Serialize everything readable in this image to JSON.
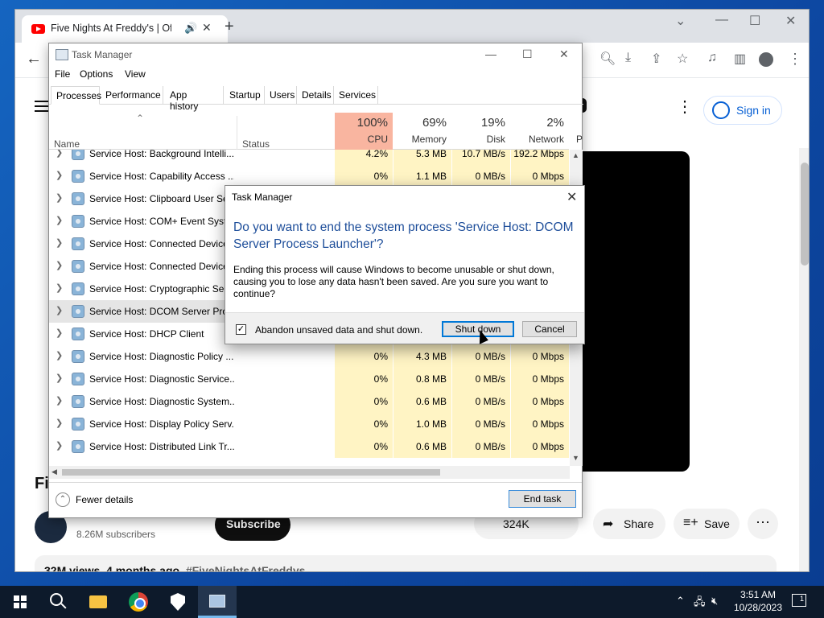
{
  "browser": {
    "tab_title": "Five Nights At Freddy's | Offi",
    "new_tab": "+"
  },
  "youtube": {
    "sign_in": "Sign in",
    "title_partial": "Fi",
    "channel_subscribers": "8.26M subscribers",
    "subscribe": "Subscribe",
    "likes_partial": "324K",
    "share": "Share",
    "save": "Save",
    "views": "32M views",
    "age": "4 months ago",
    "hashtag": "#FiveNightsAtFreddys"
  },
  "task_manager": {
    "title": "Task Manager",
    "menu": [
      "File",
      "Options",
      "View"
    ],
    "tabs": [
      "Processes",
      "Performance",
      "App history",
      "Startup",
      "Users",
      "Details",
      "Services"
    ],
    "columns": {
      "name": "Name",
      "status": "Status",
      "cpu_pct": "100%",
      "cpu": "CPU",
      "mem_pct": "69%",
      "mem": "Memory",
      "disk_pct": "19%",
      "disk": "Disk",
      "net_pct": "2%",
      "net": "Network",
      "power_partial": "P"
    },
    "rows": [
      {
        "name": "Service Host: Background Intelli...",
        "cpu": "4.2%",
        "mem": "5.3 MB",
        "disk": "10.7 MB/s",
        "net": "192.2 Mbps"
      },
      {
        "name": "Service Host: Capability Access ...",
        "cpu": "0%",
        "mem": "1.1 MB",
        "disk": "0 MB/s",
        "net": "0 Mbps"
      },
      {
        "name": "Service Host: Clipboard User Ser",
        "cpu": "",
        "mem": "",
        "disk": "",
        "net": ""
      },
      {
        "name": "Service Host: COM+ Event Syste",
        "cpu": "",
        "mem": "",
        "disk": "",
        "net": ""
      },
      {
        "name": "Service Host: Connected Device",
        "cpu": "",
        "mem": "",
        "disk": "",
        "net": ""
      },
      {
        "name": "Service Host: Connected Device",
        "cpu": "",
        "mem": "",
        "disk": "",
        "net": ""
      },
      {
        "name": "Service Host: Cryptographic Ser",
        "cpu": "",
        "mem": "",
        "disk": "",
        "net": ""
      },
      {
        "name": "Service Host: DCOM Server Proc",
        "cpu": "",
        "mem": "",
        "disk": "",
        "net": "",
        "selected": true
      },
      {
        "name": "Service Host: DHCP Client",
        "cpu": "",
        "mem": "",
        "disk": "",
        "net": ""
      },
      {
        "name": "Service Host: Diagnostic Policy ...",
        "cpu": "0%",
        "mem": "4.3 MB",
        "disk": "0 MB/s",
        "net": "0 Mbps"
      },
      {
        "name": "Service Host: Diagnostic Service...",
        "cpu": "0%",
        "mem": "0.8 MB",
        "disk": "0 MB/s",
        "net": "0 Mbps"
      },
      {
        "name": "Service Host: Diagnostic System...",
        "cpu": "0%",
        "mem": "0.6 MB",
        "disk": "0 MB/s",
        "net": "0 Mbps"
      },
      {
        "name": "Service Host: Display Policy Serv...",
        "cpu": "0%",
        "mem": "1.0 MB",
        "disk": "0 MB/s",
        "net": "0 Mbps"
      },
      {
        "name": "Service Host: Distributed Link Tr...",
        "cpu": "0%",
        "mem": "0.6 MB",
        "disk": "0 MB/s",
        "net": "0 Mbps"
      }
    ],
    "fewer_details": "Fewer details",
    "end_task": "End task"
  },
  "dialog": {
    "title": "Task Manager",
    "heading": "Do you want to end the system process 'Service Host: DCOM Server Process Launcher'?",
    "body": "Ending this process will cause Windows to become unusable or shut down, causing you to lose any data hasn't been saved. Are you sure you want to continue?",
    "checkbox_label": "Abandon unsaved data and shut down.",
    "checkbox_checked": true,
    "shutdown": "Shut down",
    "cancel": "Cancel"
  },
  "taskbar": {
    "time": "3:51 AM",
    "date": "10/28/2023",
    "notifications": "1"
  }
}
